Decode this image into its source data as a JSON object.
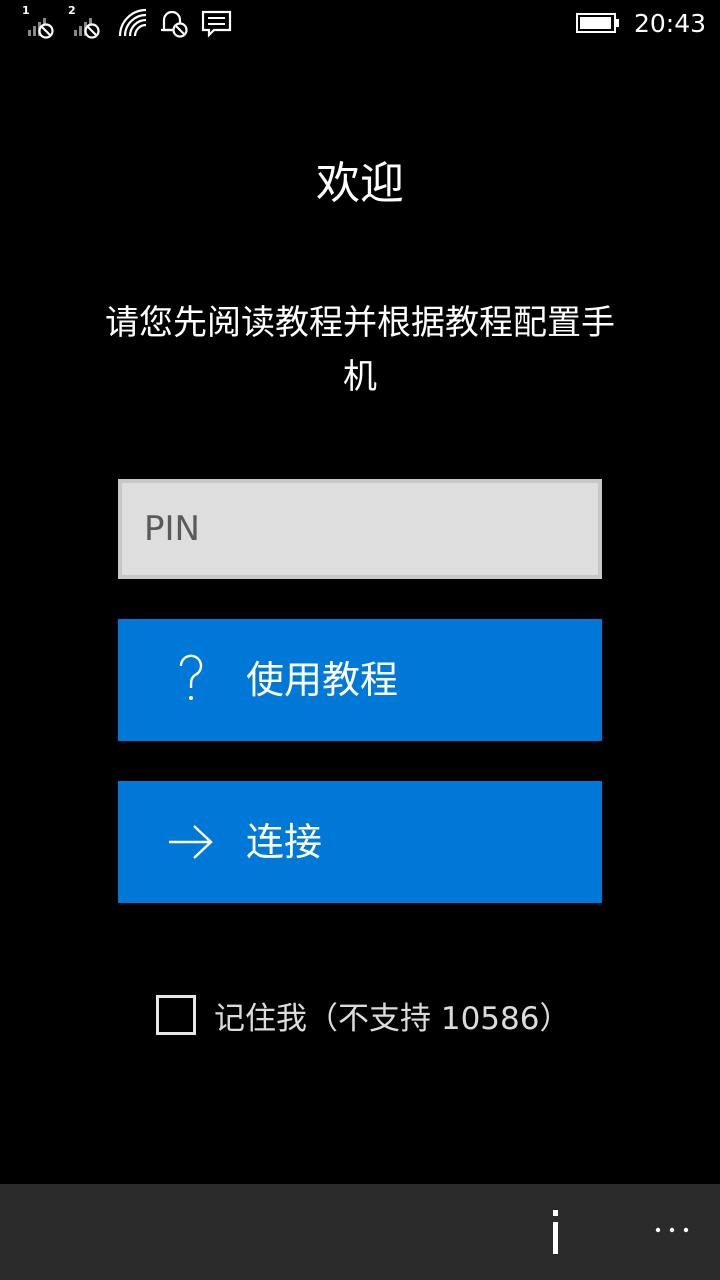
{
  "status_bar": {
    "sim1_label": "1",
    "sim2_label": "2",
    "time": "20:43",
    "icons": [
      "signal-sim1-icon",
      "signal-sim2-icon",
      "wifi-icon",
      "quiet-hours-icon",
      "message-icon",
      "battery-icon"
    ]
  },
  "main": {
    "welcome_title": "欢迎",
    "instructions": "请您先阅读教程并根据教程配置手机",
    "pin_placeholder": "PIN",
    "pin_value": "",
    "tutorial_button_label": "使用教程",
    "connect_button_label": "连接",
    "remember_me_label": "记住我（不支持 10586）",
    "remember_me_checked": false
  },
  "app_bar": {
    "info_label": "i",
    "more_label": "···"
  },
  "colors": {
    "background": "#000000",
    "accent": "#0078d7",
    "app_bar": "#2b2b2b",
    "pin_box": "#dedede"
  }
}
